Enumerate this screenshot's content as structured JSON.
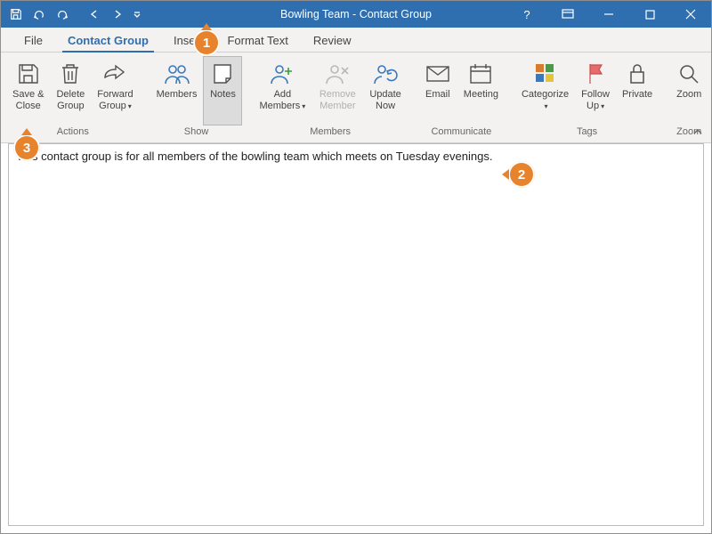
{
  "title": "Bowling Team  -  Contact Group",
  "tabs": {
    "file": "File",
    "contact_group": "Contact Group",
    "insert": "Insert",
    "format_text": "Format Text",
    "review": "Review"
  },
  "ribbon": {
    "actions": {
      "save_close": "Save &\nClose",
      "delete_group": "Delete\nGroup",
      "forward_group": "Forward\nGroup",
      "label": "Actions"
    },
    "show": {
      "members": "Members",
      "notes": "Notes",
      "label": "Show"
    },
    "members": {
      "add_members": "Add\nMembers",
      "remove_member": "Remove\nMember",
      "update_now": "Update\nNow",
      "label": "Members"
    },
    "communicate": {
      "email": "Email",
      "meeting": "Meeting",
      "label": "Communicate"
    },
    "tags": {
      "categorize": "Categorize",
      "follow_up": "Follow\nUp",
      "private": "Private",
      "label": "Tags"
    },
    "zoom": {
      "zoom": "Zoom",
      "label": "Zoom"
    }
  },
  "body_text": "This contact group is for all members of the bowling team which meets on Tuesday evenings.",
  "callouts": {
    "one": "1",
    "two": "2",
    "three": "3"
  }
}
